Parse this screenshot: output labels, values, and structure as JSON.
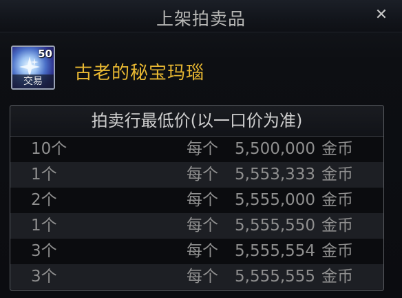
{
  "window": {
    "title": "上架拍卖品",
    "close_symbol": "✕"
  },
  "item": {
    "stack_count": "50",
    "trade_tag": "交易",
    "name": "古老的秘宝玛瑙",
    "name_color": "#e8b832",
    "icon": "gem-icon"
  },
  "auction_panel": {
    "header": "拍卖行最低价(以一口价为准)",
    "rows": [
      {
        "qty": "10个",
        "per": "每个",
        "price": "5,500,000",
        "unit": "金币"
      },
      {
        "qty": "1个",
        "per": "每个",
        "price": "5,553,333",
        "unit": "金币"
      },
      {
        "qty": "2个",
        "per": "每个",
        "price": "5,555,000",
        "unit": "金币"
      },
      {
        "qty": "1个",
        "per": "每个",
        "price": "5,555,550",
        "unit": "金币"
      },
      {
        "qty": "3个",
        "per": "每个",
        "price": "5,555,554",
        "unit": "金币"
      },
      {
        "qty": "3个",
        "per": "每个",
        "price": "5,555,555",
        "unit": "金币"
      }
    ]
  }
}
